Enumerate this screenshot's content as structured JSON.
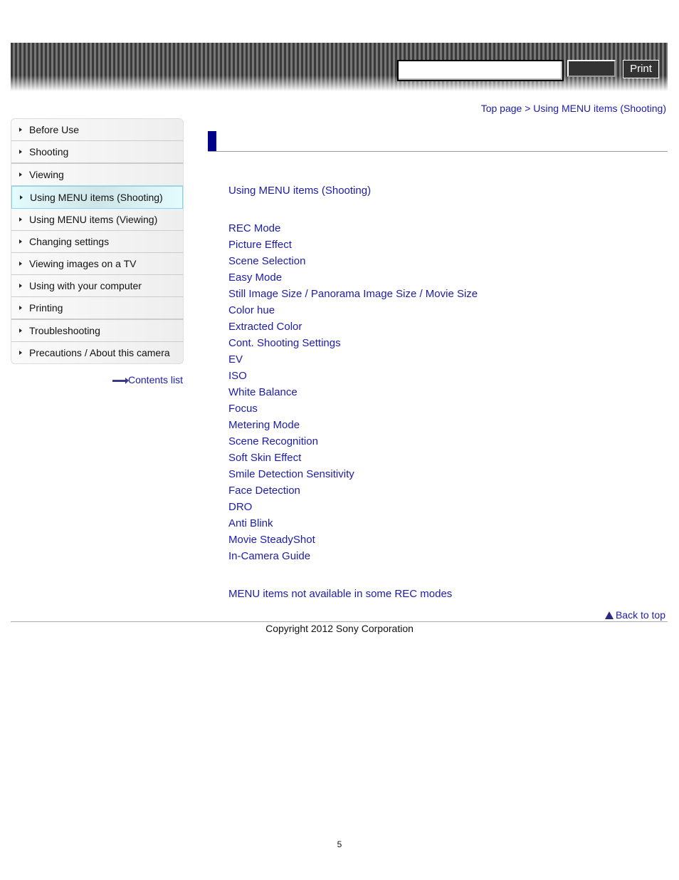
{
  "header": {
    "search_value": "",
    "search_button_label": "",
    "print_label": "Print"
  },
  "breadcrumb": {
    "text": "Top page > Using MENU items (Shooting)"
  },
  "sidebar": {
    "items": [
      {
        "label": "Before Use"
      },
      {
        "label": "Shooting"
      },
      {
        "label": "Viewing"
      },
      {
        "label": "Using MENU items (Shooting)",
        "active": true
      },
      {
        "label": "Using MENU items (Viewing)"
      },
      {
        "label": "Changing settings"
      },
      {
        "label": "Viewing images on a TV"
      },
      {
        "label": "Using with your computer"
      },
      {
        "label": "Printing"
      },
      {
        "label": "Troubleshooting"
      },
      {
        "label": "Precautions / About this camera"
      }
    ],
    "contents_list": "Contents list"
  },
  "main": {
    "top_link": "Using MENU items (Shooting)",
    "links": [
      "REC Mode",
      "Picture Effect",
      "Scene Selection",
      "Easy Mode",
      "Still Image Size / Panorama Image Size / Movie Size",
      "Color hue",
      "Extracted Color",
      "Cont. Shooting Settings",
      "EV",
      "ISO",
      "White Balance",
      "Focus",
      "Metering Mode",
      "Scene Recognition",
      "Soft Skin Effect",
      "Smile Detection Sensitivity",
      "Face Detection",
      "DRO",
      "Anti Blink",
      "Movie SteadyShot",
      "In-Camera Guide"
    ],
    "bottom_link": "MENU items not available in some REC modes",
    "accent_color": "#00008b"
  },
  "footer": {
    "back_to_top": "Back to top",
    "copyright": "Copyright 2012 Sony Corporation",
    "page_number": "5"
  }
}
